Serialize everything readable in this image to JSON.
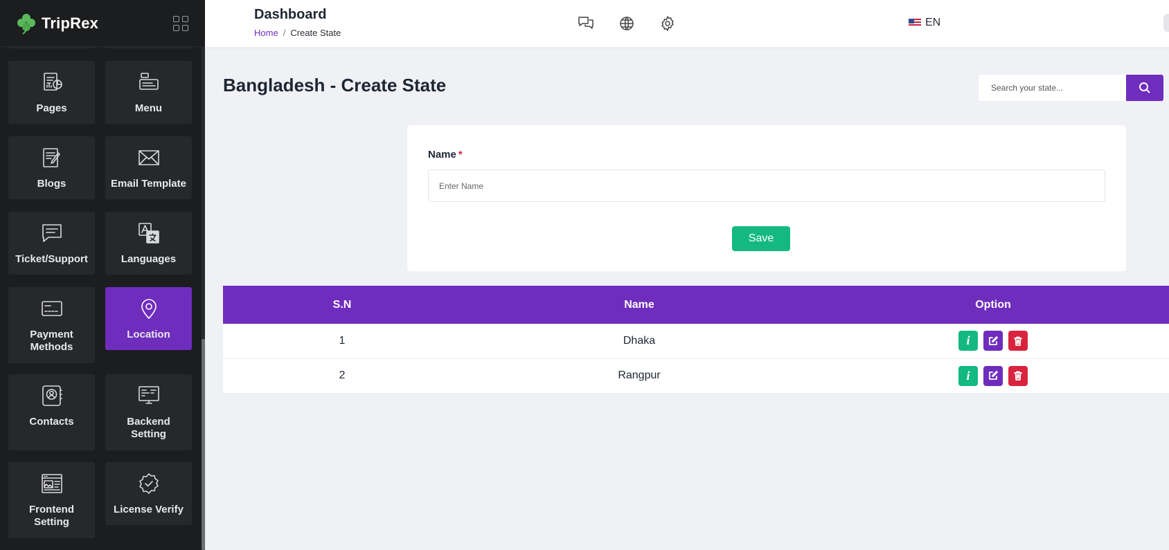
{
  "brand": {
    "name": "TripRex"
  },
  "sidebar": {
    "items": [
      {
        "label": "Pages",
        "icon": "pages-icon",
        "active": false
      },
      {
        "label": "Menu",
        "icon": "menu-icon",
        "active": false
      },
      {
        "label": "Blogs",
        "icon": "blogs-icon",
        "active": false
      },
      {
        "label": "Email Template",
        "icon": "envelope-icon",
        "active": false
      },
      {
        "label": "Ticket/Support",
        "icon": "message-icon",
        "active": false
      },
      {
        "label": "Languages",
        "icon": "translate-icon",
        "active": false
      },
      {
        "label": "Payment Methods",
        "icon": "card-icon",
        "active": false
      },
      {
        "label": "Location",
        "icon": "location-pin-icon",
        "active": true
      },
      {
        "label": "Contacts",
        "icon": "contact-icon",
        "active": false
      },
      {
        "label": "Backend Setting",
        "icon": "monitor-icon",
        "active": false
      },
      {
        "label": "Frontend Setting",
        "icon": "browser-icon",
        "active": false
      },
      {
        "label": "License Verify",
        "icon": "badge-check-icon",
        "active": false
      }
    ]
  },
  "header": {
    "title": "Dashboard",
    "breadcrumb": {
      "home": "Home",
      "separator": "/",
      "current": "Create State"
    },
    "icons": [
      "chat-icon",
      "globe-icon",
      "gear-icon"
    ],
    "language": {
      "code": "EN",
      "flag": "us-flag-icon"
    }
  },
  "main": {
    "title": "Bangladesh - Create State",
    "search": {
      "placeholder": "Search your state..."
    },
    "form": {
      "name_label": "Name",
      "required_mark": "*",
      "name_placeholder": "Enter Name",
      "save_label": "Save"
    },
    "table": {
      "headers": [
        "S.N",
        "Name",
        "Option"
      ],
      "rows": [
        {
          "sn": "1",
          "name": "Dhaka"
        },
        {
          "sn": "2",
          "name": "Rangpur"
        }
      ],
      "actions": [
        "info-icon",
        "edit-icon",
        "trash-icon"
      ]
    }
  },
  "colors": {
    "accent": "#6f2dbd",
    "success": "#14b982",
    "danger": "#d9233e",
    "sidebar_bg": "#1c1d1f",
    "tile_bg": "#27282b",
    "page_bg": "#f0f1f5"
  }
}
